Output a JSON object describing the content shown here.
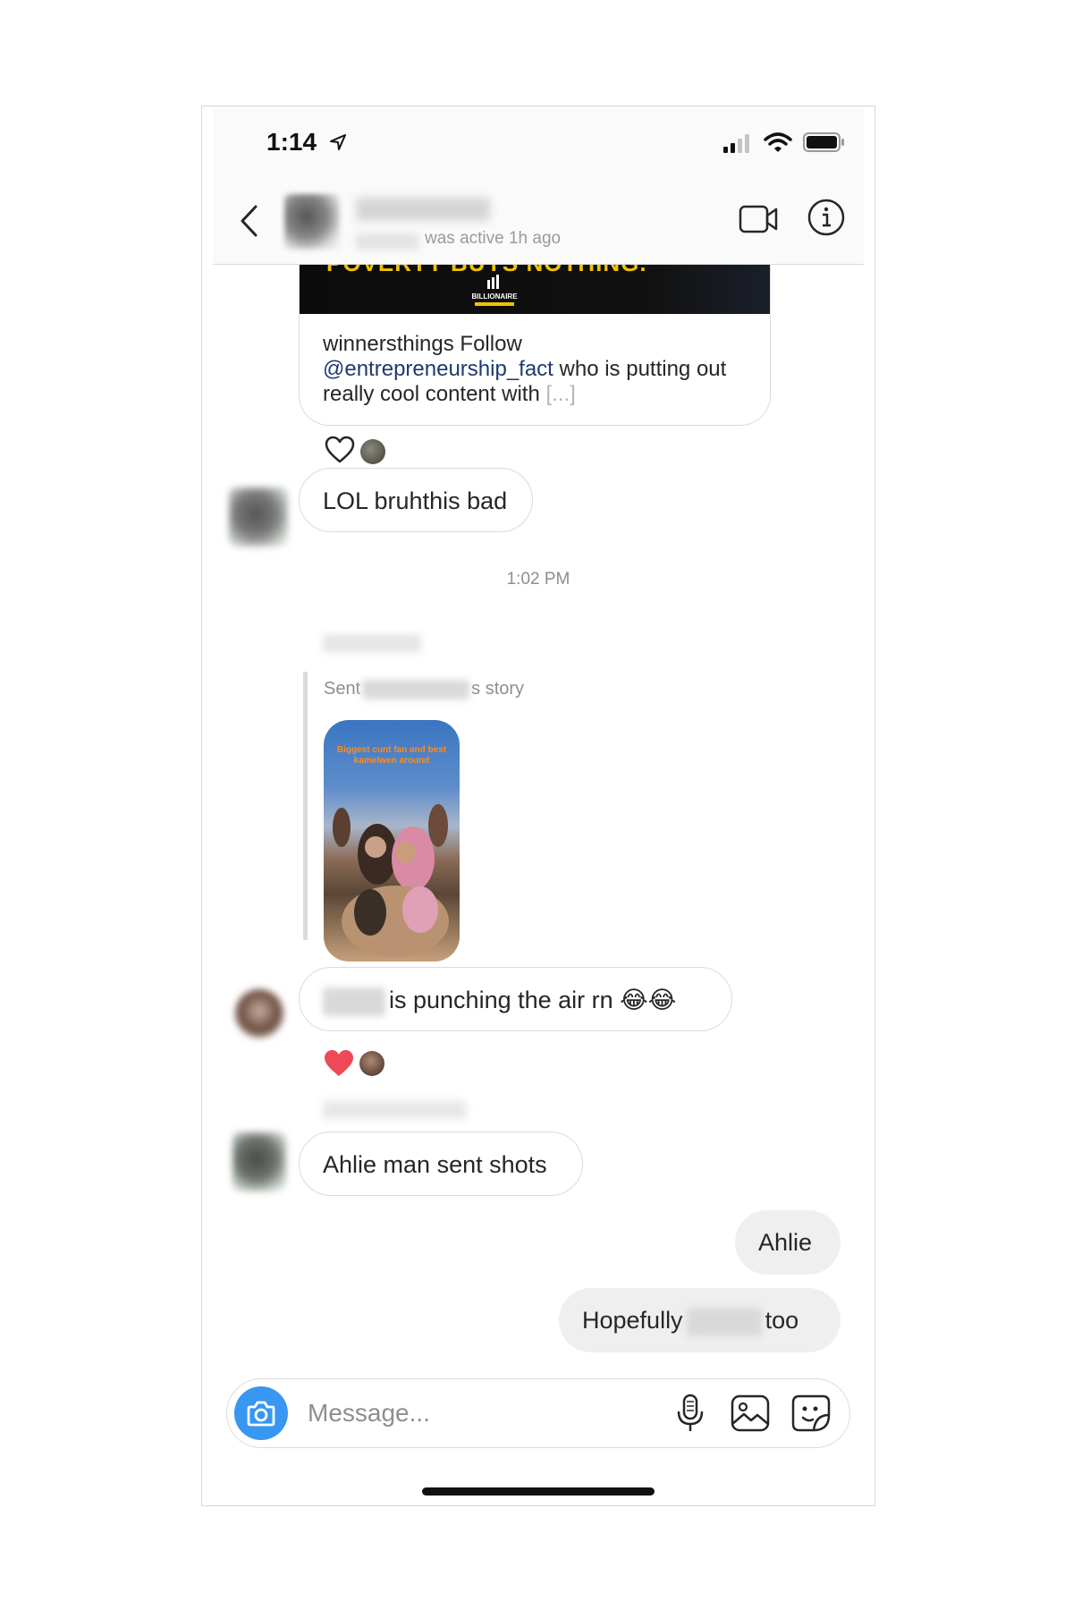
{
  "status_bar": {
    "time": "1:14",
    "icons": [
      "location-arrow-icon",
      "cellular-signal-icon",
      "wifi-icon",
      "battery-icon"
    ]
  },
  "header": {
    "status_text": "was active 1h ago",
    "icons": [
      "back-chevron-icon",
      "video-camera-icon",
      "info-icon"
    ]
  },
  "shared_post": {
    "image_headline": "POVERTY BUYS NOTHING.",
    "image_logo_text": "BILLIONAIRE",
    "account": "winnersthings",
    "caption_pre": " Follow ",
    "mention": "@entrepreneurship_fact",
    "caption_post": " who is putting out really cool content with ",
    "ellipsis": "[...]"
  },
  "messages": [
    {
      "side": "in",
      "text": "LOL bruhthis bad"
    },
    {
      "side": "in",
      "text": "is punching the air rn 😂😂"
    },
    {
      "side": "in",
      "text": "Ahlie man sent shots"
    },
    {
      "side": "out",
      "text": "Ahlie"
    },
    {
      "side": "out",
      "text_pre": "Hopefully",
      "text_post": "too"
    }
  ],
  "timestamp": "1:02 PM",
  "story_reply": {
    "label_pre": "Sent",
    "label_post": "s story",
    "story_caption": "Biggest cunt fan and best kamelwen around"
  },
  "compose": {
    "placeholder": "Message...",
    "icons": [
      "camera-icon",
      "microphone-icon",
      "gallery-icon",
      "sticker-icon"
    ]
  },
  "colors": {
    "accent": "#3897f0",
    "heart_red": "#ed4956",
    "mention": "#1e3a6e",
    "outgoing_bubble": "#efefef"
  }
}
